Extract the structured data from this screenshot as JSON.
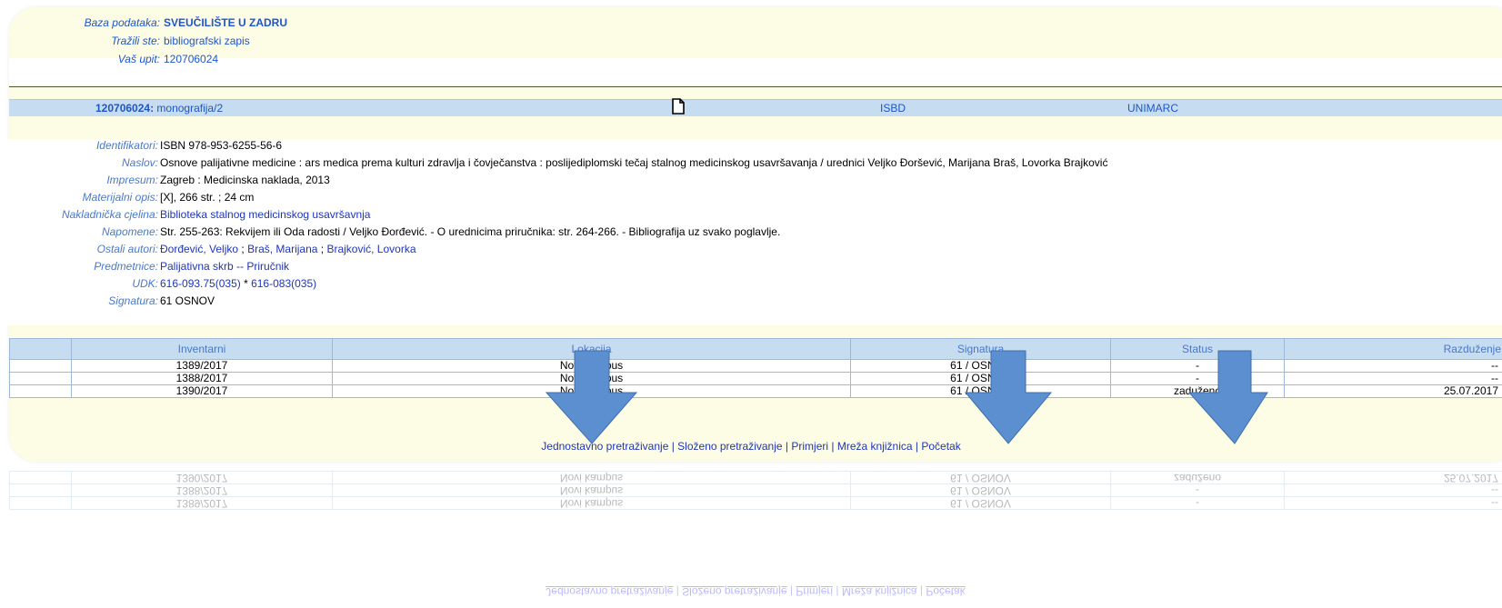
{
  "query": {
    "database_label": "Baza podataka:",
    "database_value": "SVEUČILIŠTE U ZADRU",
    "searched_label": "Tražili ste:",
    "searched_value": "bibliografski zapis",
    "query_label": "Vaš upit:",
    "query_value": "120706024"
  },
  "record_header": {
    "record_id": "120706024:",
    "record_type": "monografija/2",
    "doc_icon": "document-icon",
    "isbd_label": "ISBD",
    "unimarc_label": "UNIMARC"
  },
  "fields": [
    {
      "label": "Identifikatori:",
      "value": "ISBN 978-953-6255-56-6"
    },
    {
      "label": "Naslov:",
      "value": "Osnove palijativne medicine : ars medica prema kulturi zdravlja i čovječanstva : poslijediplomski tečaj stalnog medicinskog usavršavanja / urednici Veljko Đoršević, Marijana Braš, Lovorka Brajković"
    },
    {
      "label": "Impresum:",
      "value": "Zagreb : Medicinska naklada, 2013"
    },
    {
      "label": "Materijalni opis:",
      "value": "[X], 266 str. ; 24 cm"
    },
    {
      "label": "Nakladnička cjelina:",
      "link": "Biblioteka stalnog medicinskog usavršavnja"
    },
    {
      "label": "Napomene:",
      "value": "Str. 255-263: Rekvijem ili Oda radosti / Veljko Đorđević. - O urednicima priručnika: str. 264-266. - Bibliografija uz svako poglavlje."
    },
    {
      "label": "Ostali autori:",
      "links": [
        "Đorđević, Veljko",
        "Braš, Marijana",
        "Brajković, Lovorka"
      ],
      "separator": " ; "
    },
    {
      "label": "Predmetnice:",
      "link": "Palijativna skrb -- Priručnik"
    },
    {
      "label": "UDK:",
      "links": [
        "616-093.75(035)",
        "616-083(035)"
      ],
      "separator": " * "
    },
    {
      "label": "Signatura:",
      "value": "61 OSNOV"
    }
  ],
  "holdings": {
    "columns": [
      "",
      "Inventarni",
      "Lokacija",
      "Signatura",
      "Status",
      "Razduženje"
    ],
    "rows": [
      [
        "",
        "1389/2017",
        "Novi kampus",
        "61 / OSNOV",
        "-",
        "--"
      ],
      [
        "",
        "1388/2017",
        "Novi kampus",
        "61 / OSNOV",
        "-",
        "--"
      ],
      [
        "",
        "1390/2017",
        "Novi kampus",
        "61 / OSNOV",
        "zaduženo",
        "25.07.2017"
      ]
    ]
  },
  "footer_links": [
    "Jednostavno pretraživanje",
    "Složeno pretraživanje",
    "Primjeri",
    "Mreža knjižnica",
    "Početak"
  ],
  "footer_separator": " | ",
  "colors": {
    "panel": "#fdfde6",
    "header_band": "#c6dcf1",
    "link": "#1f35b8",
    "label": "#4a79c9",
    "arrow": "#5b8fd0"
  }
}
